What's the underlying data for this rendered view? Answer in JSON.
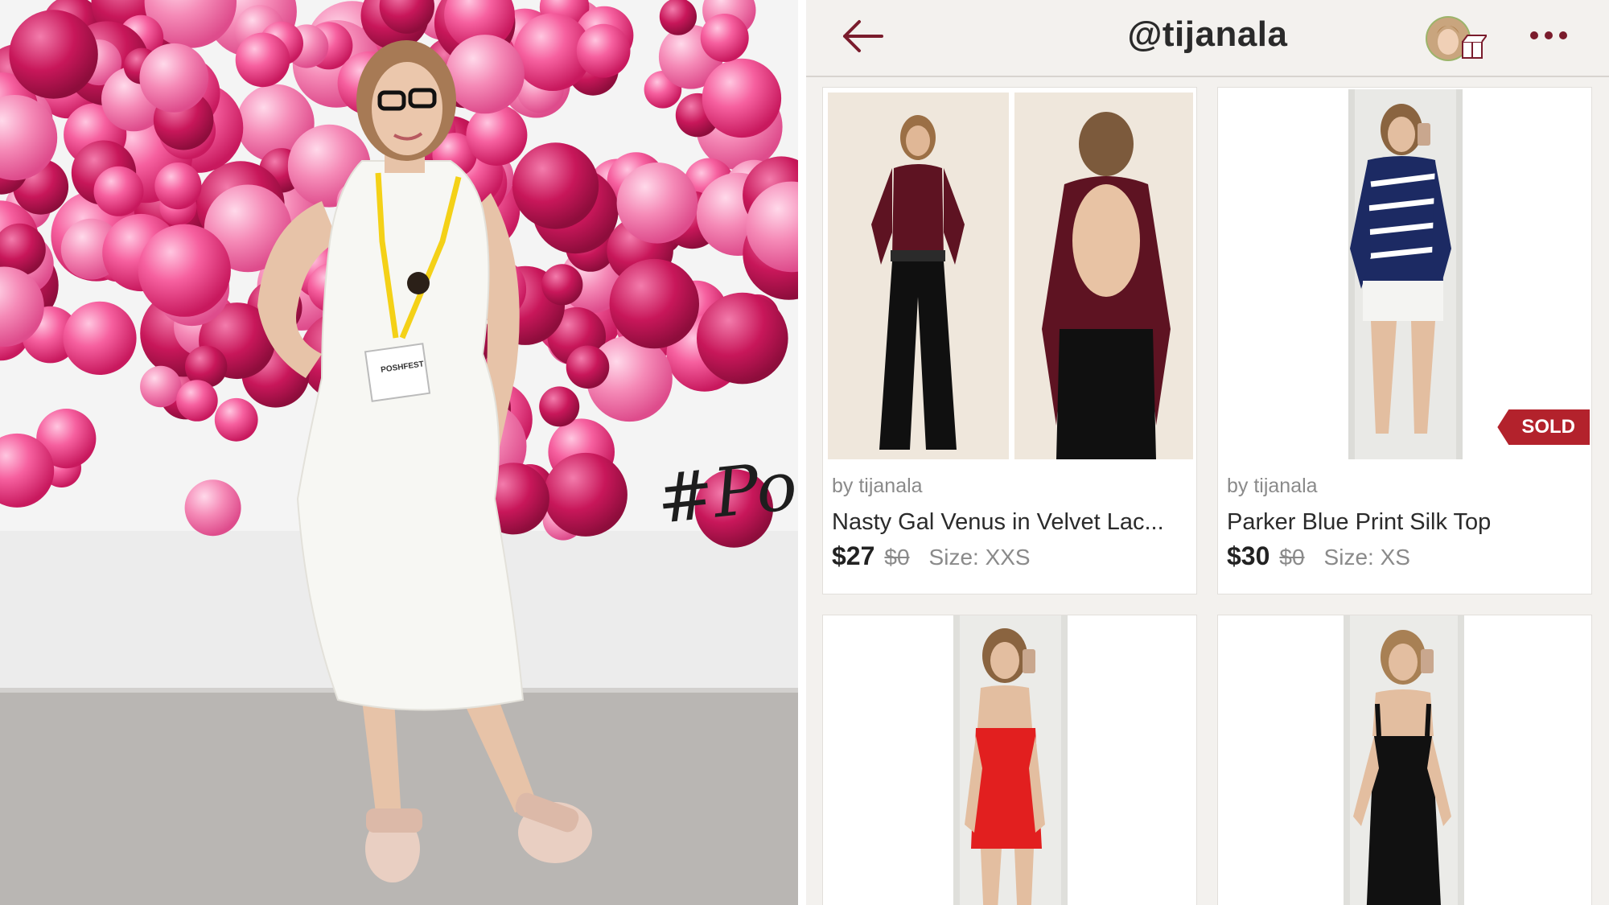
{
  "photo": {
    "badge_text": "POSHFEST",
    "wall_text": "#PoshL"
  },
  "header": {
    "title": "@tijanala",
    "back_icon": "arrow-left-icon",
    "more_icon": "more-dots-icon",
    "accent_color": "#7a1c2c"
  },
  "listings": [
    {
      "seller": "by tijanala",
      "name": "Nasty Gal Venus in Velvet Lac...",
      "price": "$27",
      "original_price": "$0",
      "size": "Size: XXS",
      "sold": false
    },
    {
      "seller": "by tijanala",
      "name": "Parker Blue Print Silk Top",
      "price": "$30",
      "original_price": "$0",
      "size": "Size: XS",
      "sold": true,
      "sold_label": "SOLD"
    },
    {},
    {}
  ],
  "colors": {
    "sold_badge": "#b3222c",
    "app_background": "#f3f1ee"
  }
}
